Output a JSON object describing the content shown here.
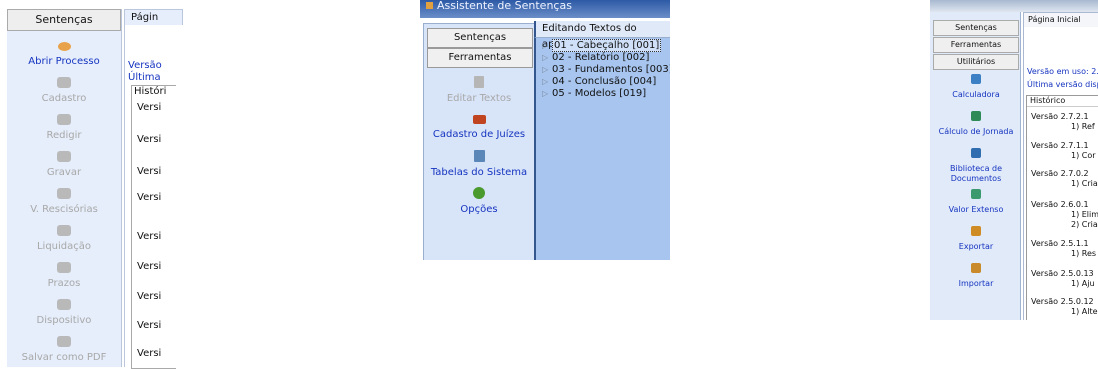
{
  "panel_a": {
    "tab_label": "Sentenças",
    "right_tab_label": "Págin",
    "version_in_use": "Versão",
    "latest_version": "Última",
    "history_header": "Históri",
    "actions": [
      {
        "label": "Abrir Processo",
        "icon": "folder-open-icon",
        "enabled": true
      },
      {
        "label": "Cadastro",
        "icon": "document-edit-icon",
        "enabled": false
      },
      {
        "label": "Redigir",
        "icon": "pencil-icon",
        "enabled": false
      },
      {
        "label": "Gravar",
        "icon": "floppy-disk-icon",
        "enabled": false
      },
      {
        "label": "V. Rescisórias",
        "icon": "calculator-icon",
        "enabled": false
      },
      {
        "label": "Liquidação",
        "icon": "money-icon",
        "enabled": false
      },
      {
        "label": "Prazos",
        "icon": "calendar-icon",
        "enabled": false
      },
      {
        "label": "Dispositivo",
        "icon": "gavel-icon",
        "enabled": false
      },
      {
        "label": "Salvar como PDF",
        "icon": "pdf-icon",
        "enabled": false
      }
    ],
    "history_rows": [
      "Versi",
      "Versi",
      "Versi",
      "Versi",
      "Versi",
      "Versi",
      "Versi",
      "Versi",
      "Versi"
    ]
  },
  "panel_b": {
    "window_title": "Assistente de Sentenças",
    "tab_sentencas": "Sentenças",
    "tab_ferramentas": "Ferramentas",
    "editing_header": "Editando Textos do aplicativo",
    "actions": [
      {
        "label": "Editar Textos",
        "icon": "document-icon",
        "enabled": false
      },
      {
        "label": "Cadastro de Juízes",
        "icon": "users-icon",
        "enabled": true
      },
      {
        "label": "Tabelas do Sistema",
        "icon": "table-icon",
        "enabled": true
      },
      {
        "label": "Opções",
        "icon": "options-icon",
        "enabled": true
      }
    ],
    "tree": [
      {
        "label": "01 - Cabeçalho [001]",
        "selected": true
      },
      {
        "label": "02 - Relatório [002]",
        "selected": false
      },
      {
        "label": "03 - Fundamentos [003]",
        "selected": false
      },
      {
        "label": "04 - Conclusão [004]",
        "selected": false
      },
      {
        "label": "05 - Modelos [019]",
        "selected": false
      }
    ]
  },
  "panel_c": {
    "tab_sentencas": "Sentenças",
    "tab_ferramentas": "Ferramentas",
    "tab_utilitarios": "Utilitários",
    "page_tab": "Página Inicial",
    "version_in_use": "Versão em uso: 2.",
    "latest_version": "Última versão disp",
    "history_header": "Histórico",
    "actions": [
      {
        "label": "Calculadora",
        "icon": "calculator-icon"
      },
      {
        "label": "Cálculo de Jornada",
        "icon": "clock-calc-icon"
      },
      {
        "label": "Biblioteca de Documentos",
        "icon": "library-icon"
      },
      {
        "label": "Valor Extenso",
        "icon": "currency-icon"
      },
      {
        "label": "Exportar",
        "icon": "export-icon"
      },
      {
        "label": "Importar",
        "icon": "import-icon"
      }
    ],
    "history_rows": [
      {
        "version": "Versão 2.7.2.1",
        "item1": "1) Ref",
        "item2": ""
      },
      {
        "version": "Versão 2.7.1.1",
        "item1": "1) Cor",
        "item2": ""
      },
      {
        "version": "Versão 2.7.0.2",
        "item1": "1) Cria",
        "item2": ""
      },
      {
        "version": "Versão 2.6.0.1",
        "item1": "1) Elim",
        "item2": "2) Cria"
      },
      {
        "version": "Versão 2.5.1.1",
        "item1": "1) Res",
        "item2": ""
      },
      {
        "version": "Versão 2.5.0.13",
        "item1": "1) Aju",
        "item2": ""
      },
      {
        "version": "Versão 2.5.0.12",
        "item1": "1) Alte",
        "item2": ""
      }
    ]
  }
}
